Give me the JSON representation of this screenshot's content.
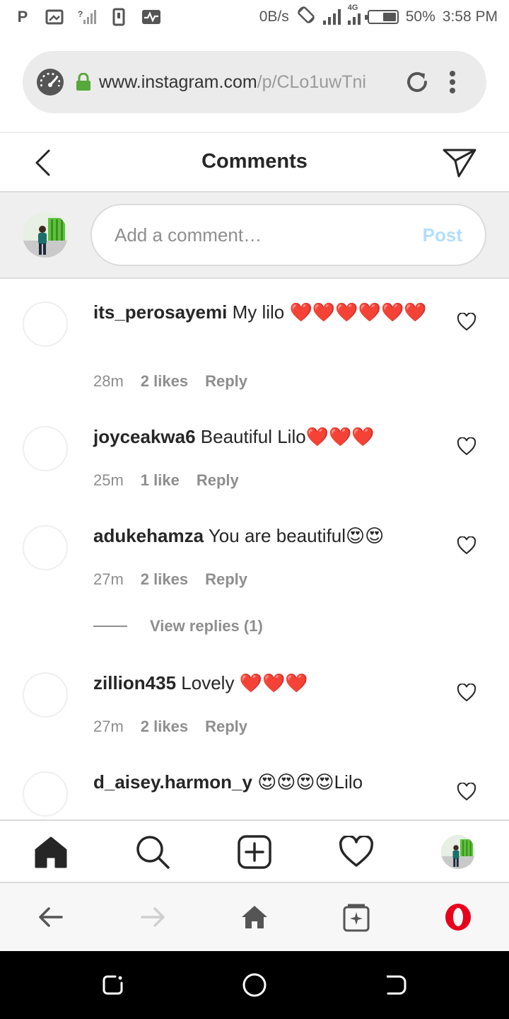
{
  "status_bar": {
    "left_icons": [
      "p-icon",
      "cast-icon",
      "no-signal-icon",
      "phone-icon",
      "activity-icon"
    ],
    "p_letter": "P",
    "speed": "0B/s",
    "network_type": "4G",
    "battery_percent": "50%",
    "battery_level": 0.5,
    "time": "3:58 PM"
  },
  "browser": {
    "url_host": "www.instagram.com",
    "url_path": "/p/CLo1uwTni"
  },
  "header": {
    "title": "Comments"
  },
  "composer": {
    "placeholder": "Add a comment…",
    "post_label": "Post",
    "post_color": "#b2dffc"
  },
  "comments": [
    {
      "username": "its_perosayemi",
      "text": "My lilo ❤️❤️❤️❤️❤️❤️",
      "time": "28m",
      "likes": "2 likes",
      "reply": "Reply"
    },
    {
      "username": "joyceakwa6",
      "text": "Beautiful Lilo❤️❤️❤️",
      "time": "25m",
      "likes": "1 like",
      "reply": "Reply"
    },
    {
      "username": "adukehamza",
      "text": "You are beautiful😍😍",
      "time": "27m",
      "likes": "2 likes",
      "reply": "Reply",
      "view_replies": "View replies (1)"
    },
    {
      "username": "zillion435",
      "text": "Lovely ❤️❤️❤️",
      "time": "27m",
      "likes": "2 likes",
      "reply": "Reply"
    },
    {
      "username": "d_aisey.harmon_y",
      "text": "😍😍😍😍Lilo"
    }
  ],
  "colors": {
    "text": "#262626",
    "secondary": "#8e8e8e",
    "divider": "#dbdbdb",
    "opera_red": "#e8001c"
  }
}
